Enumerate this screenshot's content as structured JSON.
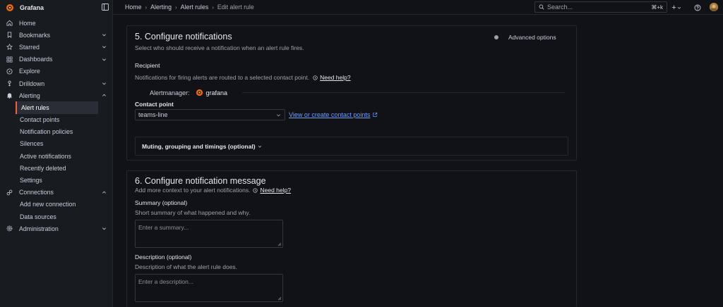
{
  "app": {
    "name": "Grafana"
  },
  "sidebar": {
    "items": [
      {
        "label": "Home",
        "icon": "home-icon"
      },
      {
        "label": "Bookmarks",
        "icon": "bookmark-icon",
        "expandable": true
      },
      {
        "label": "Starred",
        "icon": "star-icon",
        "expandable": true
      },
      {
        "label": "Dashboards",
        "icon": "apps-icon",
        "expandable": true
      },
      {
        "label": "Explore",
        "icon": "compass-icon"
      },
      {
        "label": "Drilldown",
        "icon": "drilldown-icon",
        "expandable": true
      },
      {
        "label": "Alerting",
        "icon": "bell-icon",
        "expanded": true
      },
      {
        "label": "Connections",
        "icon": "link-icon",
        "expanded": true
      },
      {
        "label": "Administration",
        "icon": "cog-icon",
        "expandable": true
      }
    ],
    "alerting_children": [
      "Alert rules",
      "Contact points",
      "Notification policies",
      "Silences",
      "Active notifications",
      "Recently deleted",
      "Settings"
    ],
    "connections_children": [
      "Add new connection",
      "Data sources"
    ],
    "active": "Alert rules"
  },
  "topbar": {
    "breadcrumbs": [
      "Home",
      "Alerting",
      "Alert rules",
      "Edit alert rule"
    ],
    "search_placeholder": "Search...",
    "search_shortcut": "⌘+k",
    "add_label": "+",
    "help_icon": "help-icon"
  },
  "section5": {
    "title": "5. Configure notifications",
    "description": "Select who should receive a notification when an alert rule fires.",
    "advanced_options": "Advanced options",
    "recipient_label": "Recipient",
    "recipient_text": "Notifications for firing alerts are routed to a selected contact point.",
    "need_help": "Need help?",
    "alertmanager_label": "Alertmanager:",
    "alertmanager_value": "grafana",
    "contact_point_label": "Contact point",
    "contact_point_value": "teams-line",
    "contact_point_link": "View or create contact points",
    "muting_label": "Muting, grouping and timings (optional)"
  },
  "section6": {
    "title": "6. Configure notification message",
    "description": "Add more context to your alert notifications.",
    "need_help": "Need help?",
    "summary_label": "Summary (optional)",
    "summary_desc": "Short summary of what happened and why.",
    "summary_placeholder": "Enter a summary...",
    "description_label": "Description (optional)",
    "description_desc": "Description of what the alert rule does.",
    "description_placeholder": "Enter a description..."
  },
  "colors": {
    "accent": "#f55f3e",
    "link": "#6e9fff",
    "background": "#111217",
    "sidebar": "#181b1f"
  }
}
